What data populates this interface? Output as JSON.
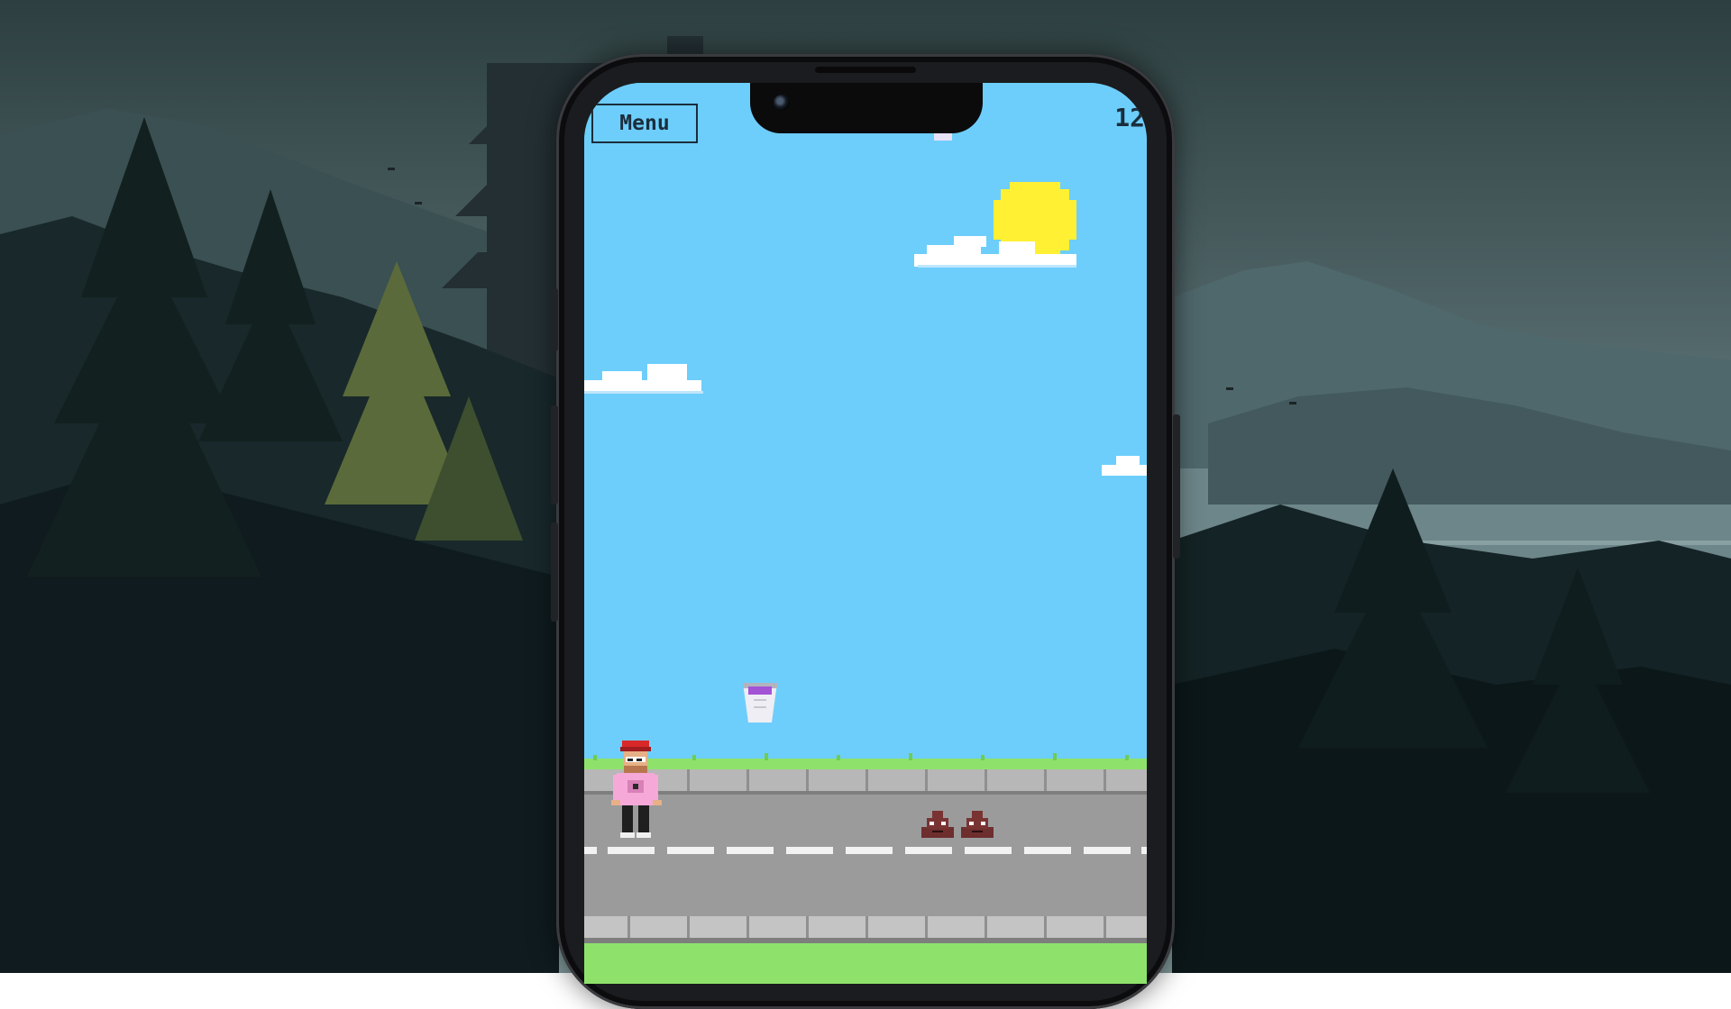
{
  "game": {
    "menu_label": "Menu",
    "score": "12"
  },
  "colors": {
    "sky": "#6dcefb",
    "sun": "#fff034",
    "road": "#9b9b9b",
    "grass": "#8ee26b",
    "player_shirt": "#f6a9d8",
    "player_cap": "#d8282a",
    "cup_drink": "#a253d6",
    "poop": "#6e2e2e"
  },
  "icons": {
    "menu": "menu-button",
    "sun": "sun-icon",
    "cloud": "cloud-icon",
    "player": "player-character",
    "cup": "purple-cup-icon",
    "obstacle": "poop-icon"
  }
}
